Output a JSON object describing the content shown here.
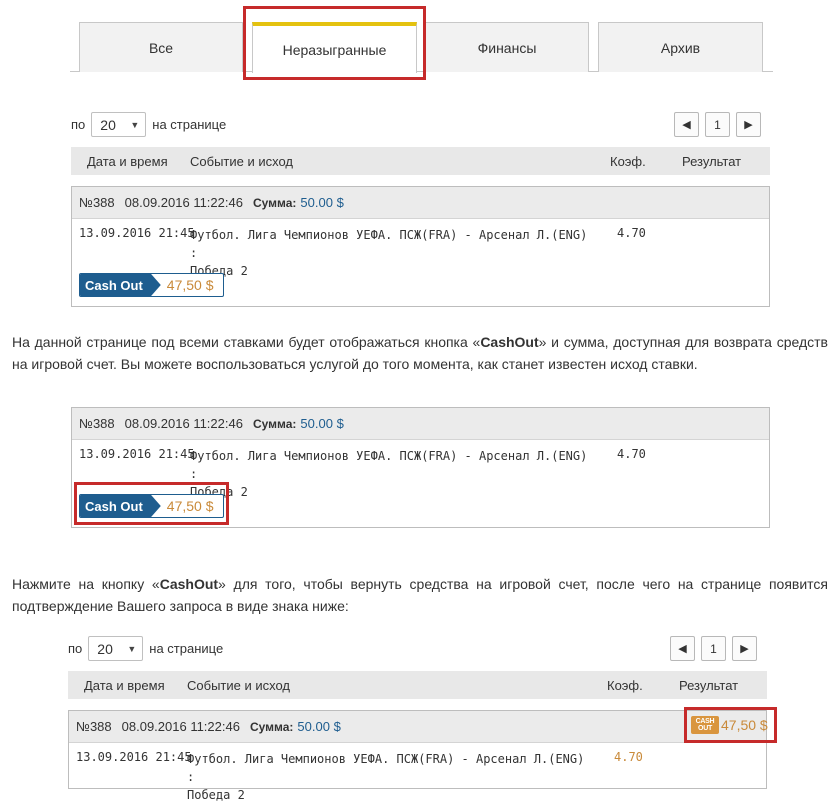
{
  "tabs": [
    {
      "label": "Все"
    },
    {
      "label": "Неразыгранные"
    },
    {
      "label": "Финансы"
    },
    {
      "label": "Архив"
    }
  ],
  "pagination": {
    "per_page_prefix": "по",
    "per_page_value": "20",
    "per_page_suffix": "на странице",
    "prev": "◀",
    "page": "1",
    "next": "▶"
  },
  "table_headers": {
    "datetime": "Дата и время",
    "event": "Событие и исход",
    "coef": "Коэф.",
    "result": "Результат"
  },
  "bet": {
    "number": "№388",
    "placed": "08.09.2016 11:22:46",
    "sum_label": "Сумма:",
    "sum_value": "50.00 $",
    "event_date": "13.09.2016 21:45",
    "event_line1": "Футбол. Лига Чемпионов УЕФА. ПСЖ(FRA) - Арсенал Л.(ENG) :",
    "event_line2": "Победа 2",
    "coef": "4.70",
    "cashout_label": "Cash Out",
    "cashout_amount": "47,50 $"
  },
  "paragraph1": {
    "before": "На данной странице под всеми ставками будет отображаться кнопка «",
    "bold": "CashOut",
    "after": "» и сумма, доступная для возврата средств на игровой счет. Вы можете воспользоваться услугой до того момента, как станет известен исход ставки."
  },
  "paragraph2": {
    "before": "Нажмите на кнопку «",
    "bold": "CashOut",
    "after": "» для того, чтобы вернуть средства на игровой счет, после чего на странице появится подтверждение Вашего запроса в виде знака ниже:"
  },
  "result_badge": {
    "icon_line1": "CASH",
    "icon_line2": "OUT",
    "amount": "47,50 $"
  },
  "colors": {
    "accent_blue": "#1e5d8f",
    "amount_orange": "#c98a3a",
    "tab_active_border": "#e4c210",
    "highlight_red": "#c62a2a"
  }
}
